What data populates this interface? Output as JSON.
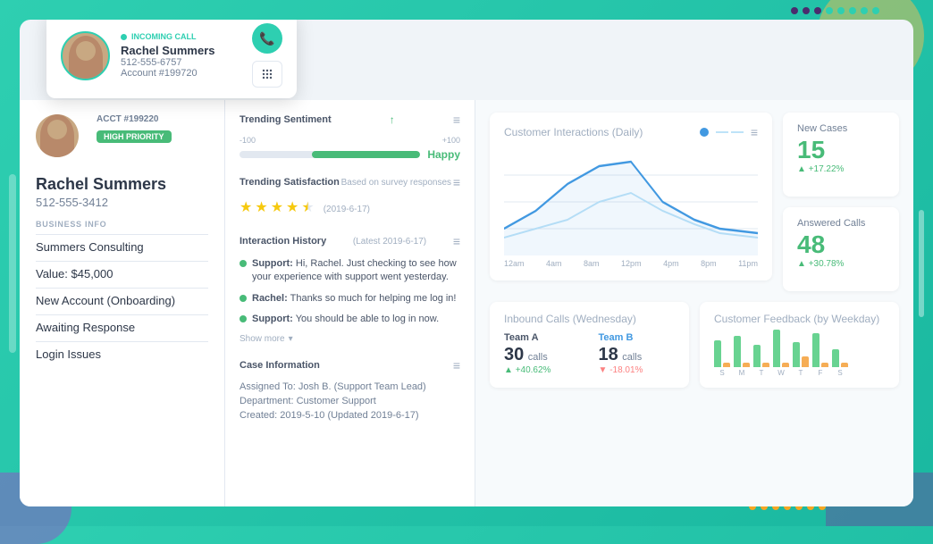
{
  "decorative": {
    "dots_top": [
      "purple",
      "purple",
      "purple",
      "teal",
      "teal",
      "teal",
      "teal",
      "teal"
    ],
    "dots_bottom": [
      "orange",
      "orange",
      "orange",
      "orange",
      "orange",
      "orange",
      "orange"
    ]
  },
  "incoming_call": {
    "label": "INCOMING CALL",
    "name": "Rachel Summers",
    "phone": "512-555-6757",
    "account": "Account #199720",
    "phone_btn_icon": "📞",
    "keypad_icon": "⌨"
  },
  "customer": {
    "acct_number": "ACCT #199220",
    "priority": "HIGH PRIORITY",
    "name": "Rachel Summers",
    "phone": "512-555-3412",
    "business_label": "BUSINESS INFO",
    "company": "Summers Consulting",
    "value": "Value: $45,000",
    "account_type": "New Account (Onboarding)",
    "status": "Awaiting Response",
    "issue": "Login Issues"
  },
  "sentiment": {
    "title": "Trending Sentiment",
    "neg_label": "-100",
    "pos_label": "+100",
    "value": "Happy",
    "fill_pct": 60
  },
  "satisfaction": {
    "title": "Trending Satisfaction",
    "subtitle": "Based on survey responses",
    "rating": 3.5,
    "date": "(2019-6-17)"
  },
  "interaction_history": {
    "title": "Interaction History",
    "latest": "(Latest 2019-6-17)",
    "items": [
      {
        "sender": "Support:",
        "text": " Hi, Rachel. Just checking to see how your experience with support went yesterday."
      },
      {
        "sender": "Rachel:",
        "text": " Thanks so much for helping me log in!"
      },
      {
        "sender": "Support:",
        "text": " You should be able to log in now."
      }
    ],
    "show_more": "Show more"
  },
  "case_info": {
    "title": "Case Information",
    "assigned": "Assigned To: Josh B. (Support Team Lead)",
    "department": "Department: Customer Support",
    "created": "Created: 2019-5-10 (Updated 2019-6-17)"
  },
  "chart": {
    "title": "Customer Interactions",
    "period": "(Daily)",
    "menu_icon": "≡",
    "time_labels": [
      "12am",
      "4am",
      "8am",
      "12pm",
      "4pm",
      "8pm",
      "11pm"
    ],
    "line1_color": "#4299e1",
    "line2_color": "#bee3f8"
  },
  "new_cases": {
    "title": "New Cases",
    "value": "15",
    "change": "+17.22%",
    "change_positive": true
  },
  "answered_calls": {
    "title": "Answered Calls",
    "value": "48",
    "change": "+30.78%",
    "change_positive": true
  },
  "inbound_calls": {
    "title": "Inbound Calls",
    "period": "(Wednesday)",
    "team_a_label": "Team A",
    "team_a_calls": "30",
    "team_a_unit": "calls",
    "team_a_change": "+40.62%",
    "team_b_label": "Team B",
    "team_b_calls": "18",
    "team_b_unit": "calls",
    "team_b_change": "-18.01%"
  },
  "customer_feedback": {
    "title": "Customer Feedback",
    "period": "(by Weekday)",
    "bars": [
      {
        "label": "S",
        "green_h": 30,
        "orange_h": 5
      },
      {
        "label": "M",
        "green_h": 35,
        "orange_h": 5
      },
      {
        "label": "T",
        "green_h": 25,
        "orange_h": 5
      },
      {
        "label": "W",
        "green_h": 42,
        "orange_h": 5
      },
      {
        "label": "T",
        "green_h": 28,
        "orange_h": 12
      },
      {
        "label": "F",
        "green_h": 38,
        "orange_h": 5
      },
      {
        "label": "S",
        "green_h": 20,
        "orange_h": 5
      }
    ],
    "bar_green": "#68d391",
    "bar_orange": "#f6ad55"
  },
  "colors": {
    "teal": "#2ecfb1",
    "green": "#48bb78",
    "blue": "#4299e1",
    "purple": "#4a2c6e",
    "orange": "#f5a623"
  }
}
